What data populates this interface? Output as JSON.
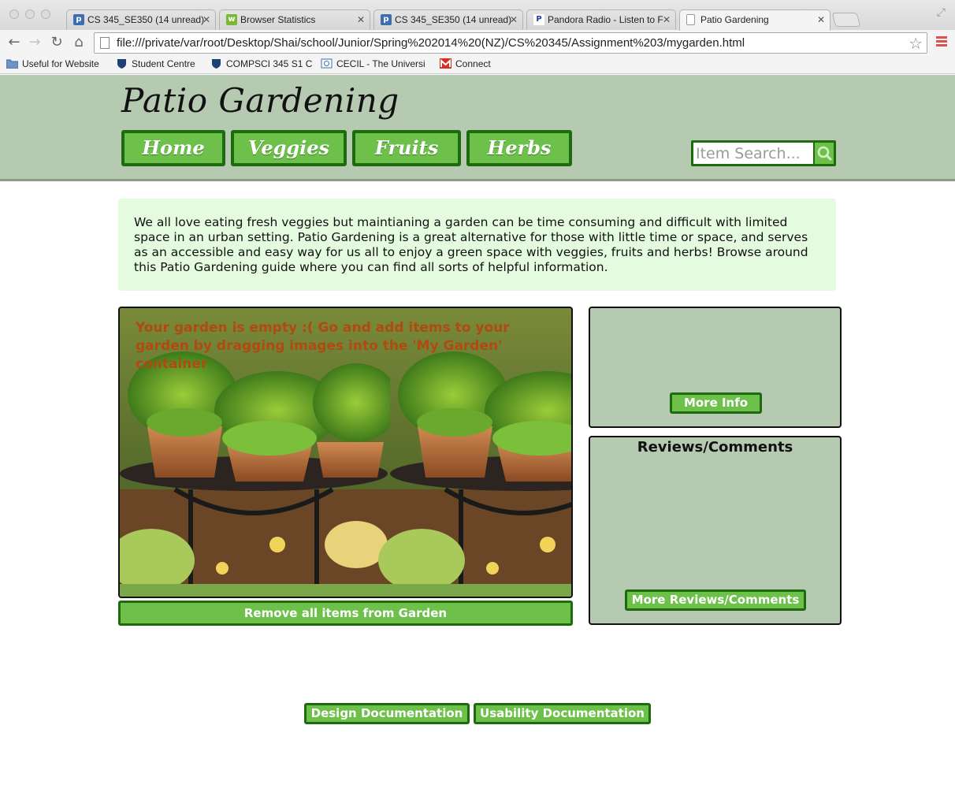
{
  "browser": {
    "tabs": [
      {
        "title": "CS 345_SE350 (14 unread)",
        "icon": "piazza-icon",
        "color": "#3d6eb0"
      },
      {
        "title": "Browser Statistics",
        "icon": "w3schools-icon",
        "color": "#7ab733"
      },
      {
        "title": "CS 345_SE350 (14 unread)",
        "icon": "piazza-icon",
        "color": "#3d6eb0"
      },
      {
        "title": "Pandora Radio - Listen to F",
        "icon": "pandora-icon",
        "color": "#224099"
      },
      {
        "title": "Patio Gardening",
        "icon": "page-icon",
        "color": "#ffffff"
      }
    ],
    "url": "file:///private/var/root/Desktop/Shai/school/Junior/Spring%202014%20(NZ)/CS%20345/Assignment%203/mygarden.html",
    "bookmarks": [
      {
        "label": "Useful for Website",
        "icon": "folder-icon"
      },
      {
        "label": "Student Centre",
        "icon": "shield-icon"
      },
      {
        "label": "COMPSCI 345 S1 C",
        "icon": "shield-icon"
      },
      {
        "label": "CECIL - The Universi",
        "icon": "cecil-icon"
      },
      {
        "label": "Connect",
        "icon": "gmail-icon"
      }
    ]
  },
  "site": {
    "title": "Patio Gardening",
    "nav": [
      "Home",
      "Veggies",
      "Fruits",
      "Herbs"
    ],
    "search_placeholder": "Item Search...",
    "intro": "We all love eating fresh veggies but maintianing a garden can be time consuming and difficult with limited space in an urban setting. Patio Gardening is a great alternative for those with little time or space, and serves as an accessible and easy way for us all to enjoy a green space with veggies, fruits and herbs! Browse around this Patio Gardening guide where you can find all sorts of helpful information.",
    "garden_message": "Your garden is empty :( Go and add items to your garden by dragging images into the 'My Garden' container",
    "remove_label": "Remove all items from Garden",
    "more_info_label": "More Info",
    "reviews_title": "Reviews/Comments",
    "more_reviews_label": "More Reviews/Comments",
    "design_doc_label": "Design Documentation",
    "usability_doc_label": "Usability Documentation"
  },
  "colors": {
    "header_bg": "#b6c9b1",
    "button_green": "#6dc04a",
    "button_border": "#1d6a0f",
    "intro_bg": "#e5fbe0",
    "garden_message": "#b04a10"
  }
}
